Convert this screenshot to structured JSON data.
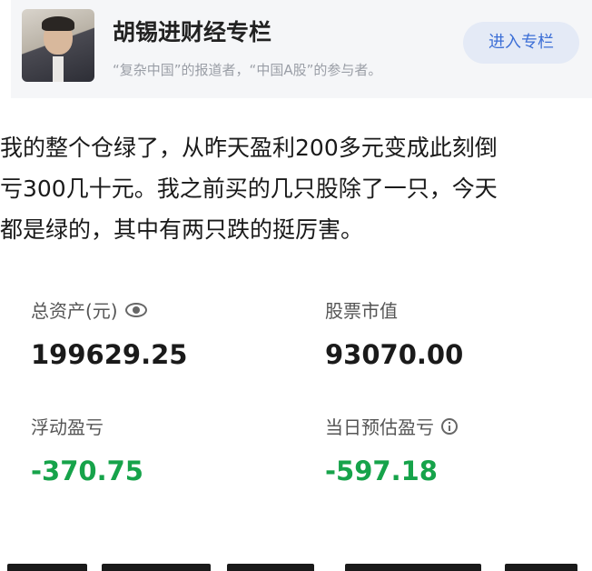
{
  "column": {
    "title": "胡锡进财经专栏",
    "description": "“复杂中国”的报道者，“中国A股”的参与者。",
    "enter_button": "进入专栏",
    "avatar_icon": "author-avatar-icon"
  },
  "post": {
    "lines": [
      "我的整个仓绿了，从昨天盈利200多元变成此刻倒",
      "亏300几十元。我之前买的几只股除了一只，今天",
      "都是绿的，其中有两只跌的挺厉害。"
    ]
  },
  "account": {
    "total_assets_label": "总资产(元)",
    "total_assets_value": "199629.25",
    "market_value_label": "股票市值",
    "market_value_value": "93070.00",
    "floating_pl_label": "浮动盈亏",
    "floating_pl_value": "-370.75",
    "today_pl_label": "当日预估盈亏",
    "today_pl_value": "-597.18",
    "loss_color": "#16a34a",
    "eye_icon": "eye-icon",
    "info_icon": "info-icon"
  }
}
